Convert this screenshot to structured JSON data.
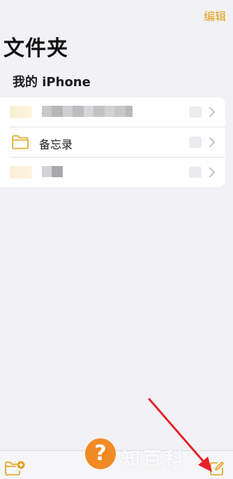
{
  "header": {
    "edit_label": "编辑",
    "title": "文件夹"
  },
  "section": {
    "title": "我的 iPhone"
  },
  "folders": [
    {
      "label": "",
      "blurred": true
    },
    {
      "label": "备忘录",
      "blurred": false
    },
    {
      "label": "",
      "blurred": true
    }
  ],
  "watermark": {
    "badge": "?",
    "text": "知百科"
  },
  "colors": {
    "accent": "#e0a21a",
    "background": "#f2f1f6",
    "annotation_arrow": "#e8202a",
    "watermark_badge": "#f08a24"
  },
  "icons": {
    "new_folder": "new-folder-icon",
    "compose": "compose-icon",
    "folder": "folder-icon",
    "chevron": "chevron-right-icon"
  }
}
